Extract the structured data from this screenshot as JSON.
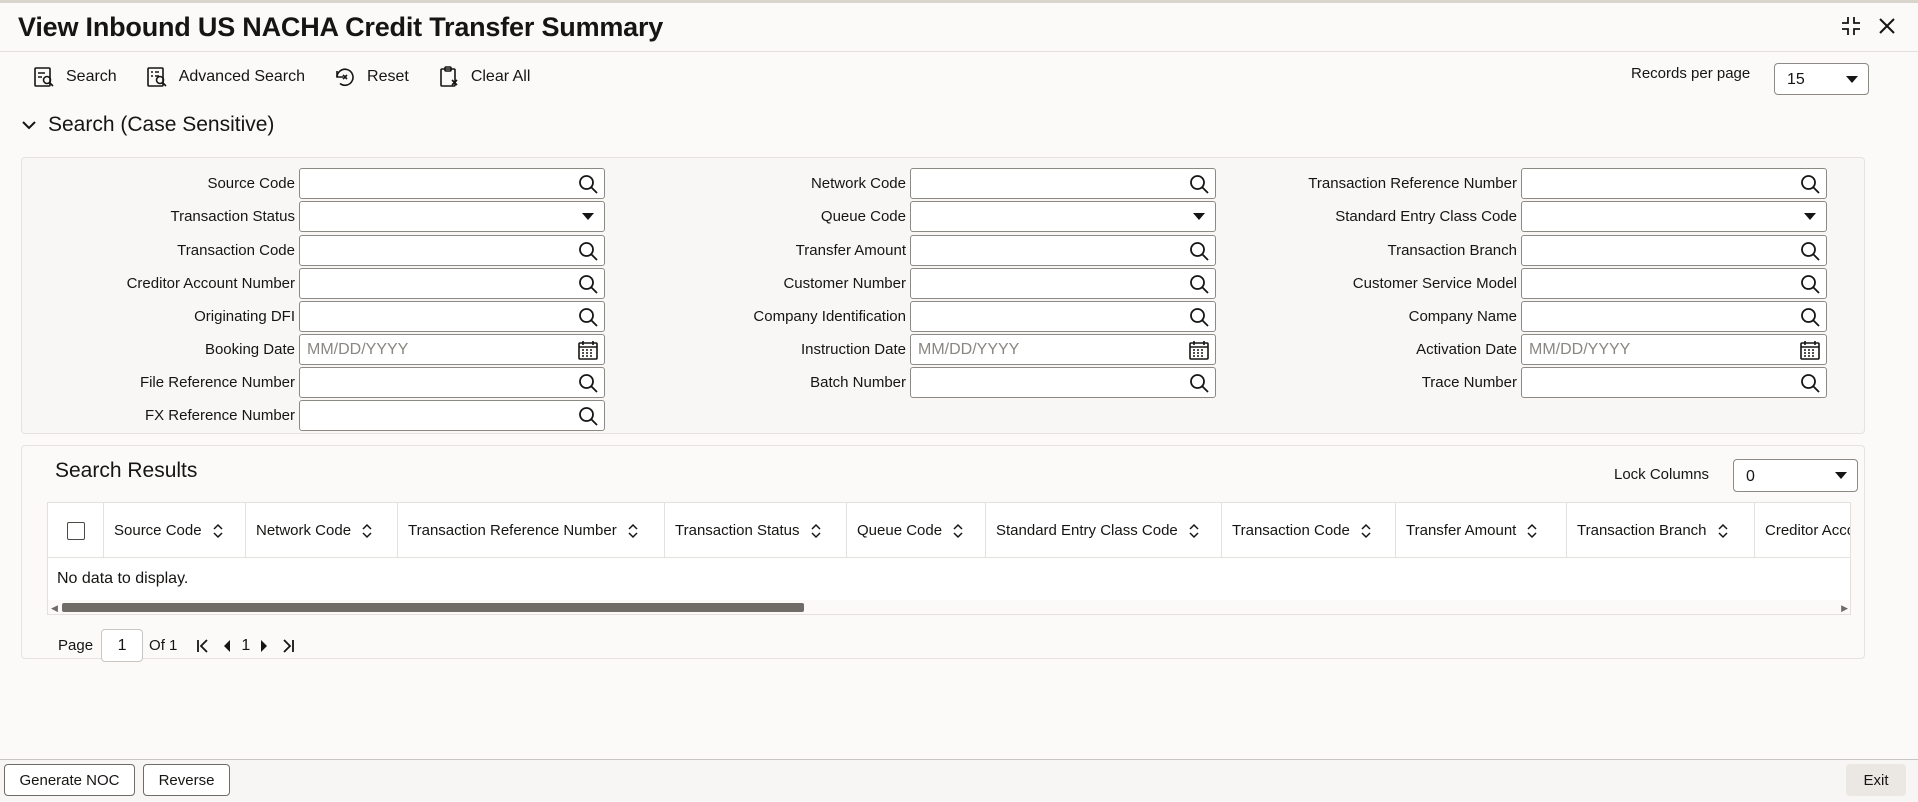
{
  "window": {
    "title": "View Inbound US NACHA Credit Transfer Summary"
  },
  "toolbar": {
    "search_label": "Search",
    "advanced_search_label": "Advanced Search",
    "reset_label": "Reset",
    "clear_all_label": "Clear All",
    "records_per_page_label": "Records per page",
    "records_per_page_value": "15"
  },
  "search_section": {
    "title": "Search (Case Sensitive)",
    "fields": {
      "source_code": {
        "label": "Source Code",
        "value": ""
      },
      "network_code": {
        "label": "Network Code",
        "value": ""
      },
      "transaction_reference_number": {
        "label": "Transaction Reference Number",
        "value": ""
      },
      "transaction_status": {
        "label": "Transaction Status",
        "value": ""
      },
      "queue_code": {
        "label": "Queue Code",
        "value": ""
      },
      "standard_entry_class_code": {
        "label": "Standard Entry Class Code",
        "value": ""
      },
      "transaction_code": {
        "label": "Transaction Code",
        "value": ""
      },
      "transfer_amount": {
        "label": "Transfer Amount",
        "value": ""
      },
      "transaction_branch": {
        "label": "Transaction Branch",
        "value": ""
      },
      "creditor_account_number": {
        "label": "Creditor Account Number",
        "value": ""
      },
      "customer_number": {
        "label": "Customer Number",
        "value": ""
      },
      "customer_service_model": {
        "label": "Customer Service Model",
        "value": ""
      },
      "originating_dfi": {
        "label": "Originating DFI",
        "value": ""
      },
      "company_identification": {
        "label": "Company Identification",
        "value": ""
      },
      "company_name": {
        "label": "Company Name",
        "value": ""
      },
      "booking_date": {
        "label": "Booking Date",
        "placeholder": "MM/DD/YYYY"
      },
      "instruction_date": {
        "label": "Instruction Date",
        "placeholder": "MM/DD/YYYY"
      },
      "activation_date": {
        "label": "Activation Date",
        "placeholder": "MM/DD/YYYY"
      },
      "file_reference_number": {
        "label": "File Reference Number",
        "value": ""
      },
      "batch_number": {
        "label": "Batch Number",
        "value": ""
      },
      "trace_number": {
        "label": "Trace Number",
        "value": ""
      },
      "fx_reference_number": {
        "label": "FX Reference Number",
        "value": ""
      }
    }
  },
  "results": {
    "title": "Search Results",
    "lock_columns_label": "Lock Columns",
    "lock_columns_value": "0",
    "columns": [
      "Source Code",
      "Network Code",
      "Transaction Reference Number",
      "Transaction Status",
      "Queue Code",
      "Standard Entry Class Code",
      "Transaction Code",
      "Transfer Amount",
      "Transaction Branch",
      "Creditor Account"
    ],
    "empty_message": "No data to display."
  },
  "pagination": {
    "page_label": "Page",
    "current_page": "1",
    "of_label": "Of 1",
    "page_number": "1"
  },
  "footer": {
    "generate_noc_label": "Generate NOC",
    "reverse_label": "Reverse",
    "exit_label": "Exit"
  }
}
